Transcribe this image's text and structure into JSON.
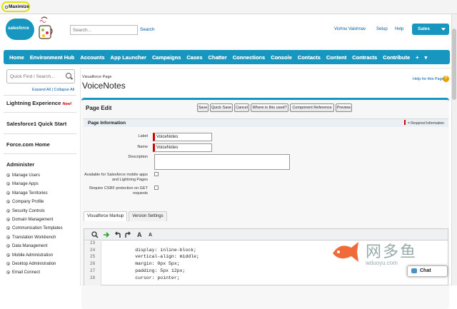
{
  "browser": {
    "maximize_label": "Maximize"
  },
  "header": {
    "logo_text": "salesforce",
    "search_placeholder": "Search...",
    "search_button": "Search",
    "user_name": "Vishnu Vaishnav",
    "setup": "Setup",
    "help": "Help",
    "app_menu": "Sales"
  },
  "tabs": [
    "Home",
    "Environment Hub",
    "Accounts",
    "App Launcher",
    "Campaigns",
    "Cases",
    "Chatter",
    "Connections",
    "Console",
    "Contacts",
    "Content",
    "Contracts",
    "Contribute",
    "+",
    "▾"
  ],
  "sidebar": {
    "quickfind_placeholder": "Quick Find / Search...",
    "expand": "Expand All | Collapse All",
    "lightning": "Lightning Experience",
    "lightning_new": "New!",
    "quickstart": "Salesforce1 Quick Start",
    "forcehome": "Force.com Home",
    "administer": "Administer",
    "items": [
      "Manage Users",
      "Manage Apps",
      "Manage Territories",
      "Company Profile",
      "Security Controls",
      "Domain Management",
      "Communication Templates",
      "Translation Workbench",
      "Data Management",
      "Mobile Administration",
      "Desktop Administration",
      "Email Connect"
    ]
  },
  "page": {
    "subtitle": "Visualforce Page",
    "title": "VoiceNotes",
    "help_link": "Help for this Page",
    "edit_title": "Page Edit",
    "buttons": [
      "Save",
      "Quick Save",
      "Cancel",
      "Where is this used?",
      "Component Reference",
      "Preview"
    ],
    "section": "Page Information",
    "required_note": "= Required Information",
    "label_label": "Label",
    "label_value": "VoiceNotes",
    "name_label": "Name",
    "name_value": "VoiceNotes",
    "description_label": "Description",
    "mobile_label": "Available for Salesforce mobile apps and Lightning Pages",
    "csrf_label": "Require CSRF protection on GET requests"
  },
  "editor": {
    "tabs": [
      "Visualforce Markup",
      "Version Settings"
    ],
    "tool_a_large": "A",
    "tool_a_small": "A",
    "lines": [
      {
        "n": "23",
        "code": ""
      },
      {
        "n": "24",
        "code": "        display: inline-block;"
      },
      {
        "n": "25",
        "code": "        vertical-align: middle;"
      },
      {
        "n": "26",
        "code": "        margin: 0px 5px;"
      },
      {
        "n": "27",
        "code": "        padding: 5px 12px;"
      },
      {
        "n": "28",
        "code": "        cursor: pointer;"
      }
    ]
  },
  "chat": "Chat",
  "watermark": {
    "cn": "网多鱼",
    "en": "wduoyu.com"
  }
}
